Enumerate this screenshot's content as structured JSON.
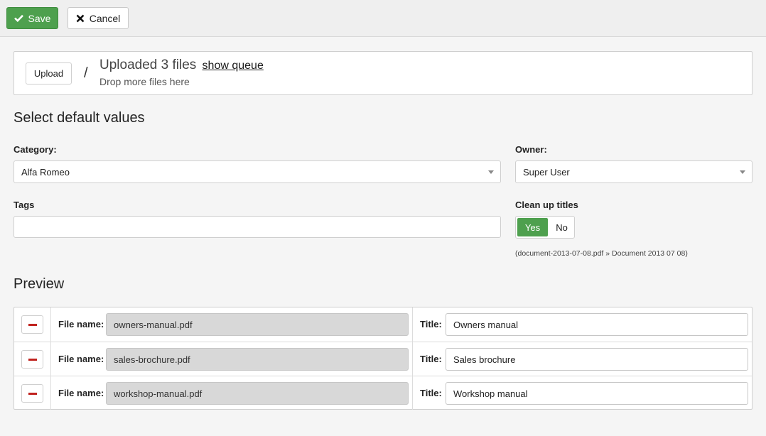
{
  "toolbar": {
    "save_label": "Save",
    "cancel_label": "Cancel"
  },
  "upload": {
    "button_label": "Upload",
    "separator": "/",
    "status": "Uploaded 3 files",
    "show_queue_link": "show queue",
    "drop_hint": "Drop more files here"
  },
  "defaults": {
    "heading": "Select default values",
    "category_label": "Category:",
    "category_value": "Alfa Romeo",
    "owner_label": "Owner:",
    "owner_value": "Super User",
    "tags_label": "Tags",
    "tags_value": "",
    "cleanup_label": "Clean up titles",
    "cleanup_yes": "Yes",
    "cleanup_no": "No",
    "cleanup_selected": "Yes",
    "cleanup_example": "(document-2013-07-08.pdf » Document 2013 07 08)"
  },
  "preview": {
    "heading": "Preview",
    "file_name_label": "File name:",
    "title_label": "Title:",
    "rows": [
      {
        "file_name": "owners-manual.pdf",
        "title": "Owners manual"
      },
      {
        "file_name": "sales-brochure.pdf",
        "title": "Sales brochure"
      },
      {
        "file_name": "workshop-manual.pdf",
        "title": "Workshop manual"
      }
    ]
  },
  "colors": {
    "accent": "#4ea04e",
    "danger": "#c0221e"
  },
  "icons": {
    "save": "check-icon",
    "cancel": "close-icon",
    "remove": "minus-icon",
    "select": "chevron-down-icon"
  }
}
